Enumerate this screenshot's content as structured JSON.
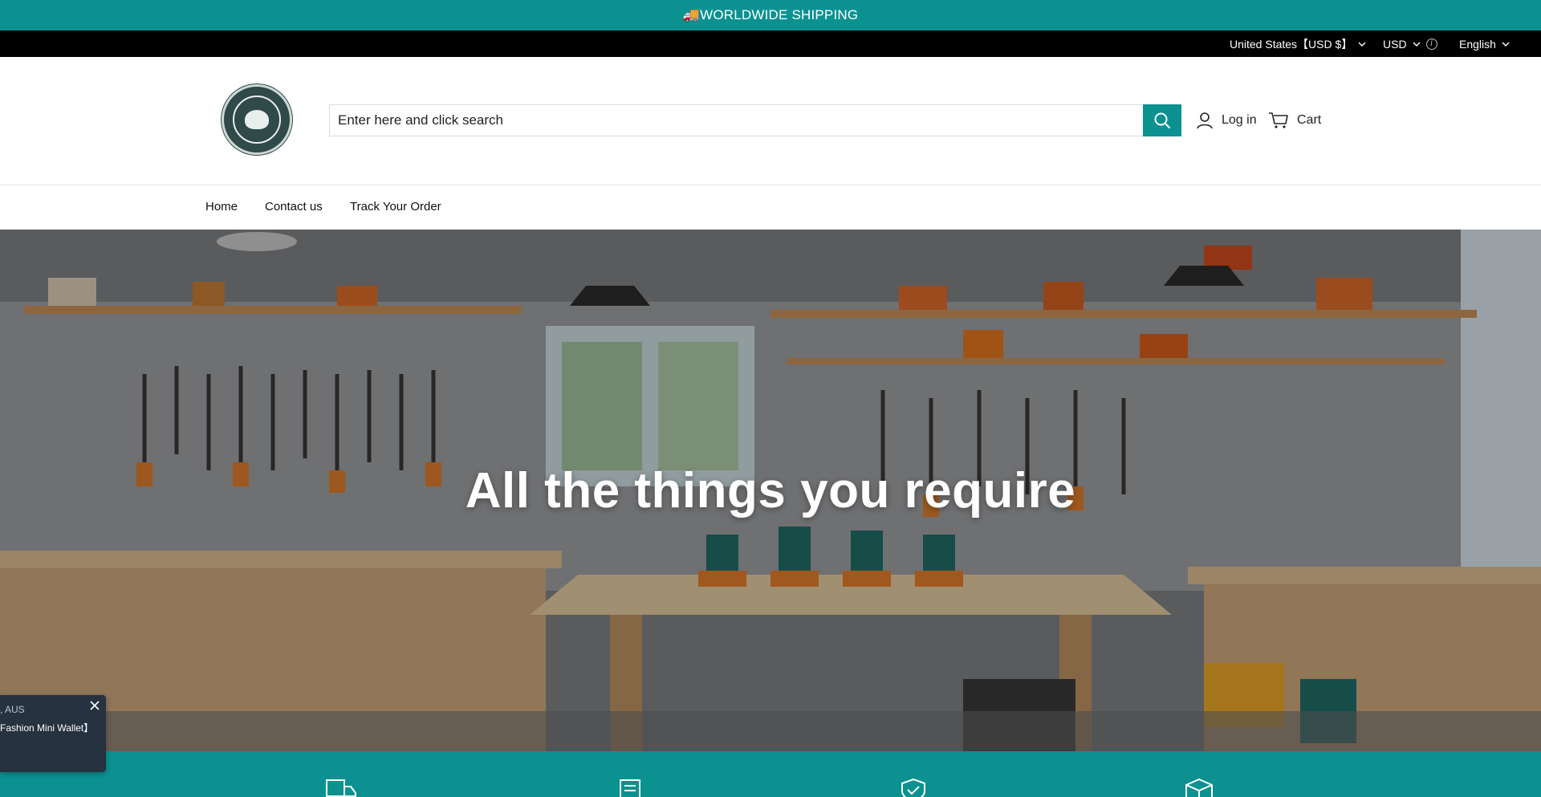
{
  "announcement": {
    "text": "🚚WORLDWIDE SHIPPING"
  },
  "localization": {
    "country": "United States【USD $】",
    "currency": "USD",
    "language": "English"
  },
  "header": {
    "logo_alt": "G.G.D.G.A",
    "search_placeholder": "Enter here and click search",
    "login_label": "Log in",
    "cart_label": "Cart"
  },
  "nav": {
    "items": [
      {
        "label": "Home"
      },
      {
        "label": "Contact us"
      },
      {
        "label": "Track Your Order"
      }
    ]
  },
  "hero": {
    "title": "All the things you require"
  },
  "popup": {
    "location": ", AUS",
    "product": "Fashion Mini Wallet】"
  },
  "colors": {
    "accent": "#0c9191",
    "topbar": "#000000",
    "popup_bg": "#26323f"
  },
  "trust_icons": [
    "delivery-truck-icon",
    "receipt-icon",
    "shield-check-icon",
    "package-box-icon"
  ]
}
